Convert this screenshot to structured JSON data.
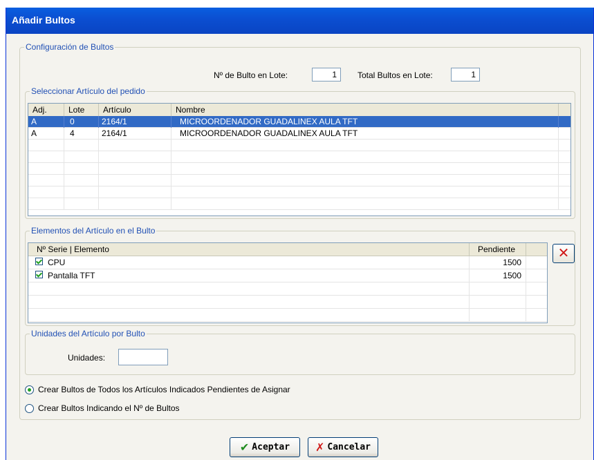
{
  "window": {
    "title": "Añadir Bultos"
  },
  "config": {
    "legend": "Configuración de Bultos",
    "bulto_label": "Nº de Bulto en Lote:",
    "bulto_value": "1",
    "total_label": "Total Bultos en Lote:",
    "total_value": "1"
  },
  "articulos": {
    "legend": "Seleccionar Artículo del pedido",
    "headers": [
      "Adj.",
      "Lote",
      "Artículo",
      "Nombre"
    ],
    "rows": [
      [
        "A",
        "0",
        "2164/1",
        "MICROORDENADOR GUADALINEX AULA TFT"
      ],
      [
        "A",
        "4",
        "2164/1",
        "MICROORDENADOR GUADALINEX AULA TFT"
      ]
    ]
  },
  "elementos": {
    "legend": "Elementos del Artículo en el Bulto",
    "headers": [
      "Nº Serie |  Elemento",
      "Pendiente"
    ],
    "rows": [
      [
        "CPU",
        "1500"
      ],
      [
        "Pantalla TFT",
        "1500"
      ]
    ],
    "delete_icon": "✕"
  },
  "unidades": {
    "legend": "Unidades del Artículo por Bulto",
    "label": "Unidades:",
    "value": ""
  },
  "options": {
    "radio1": "Crear Bultos de Todos los Artículos Indicados Pendientes de Asignar",
    "radio2": "Crear Bultos Indicando el Nº de Bultos",
    "selected": "radio1"
  },
  "buttons": {
    "accept": "Aceptar",
    "accept_icon": "✔",
    "cancel": "Cancelar",
    "cancel_icon": "✗"
  }
}
